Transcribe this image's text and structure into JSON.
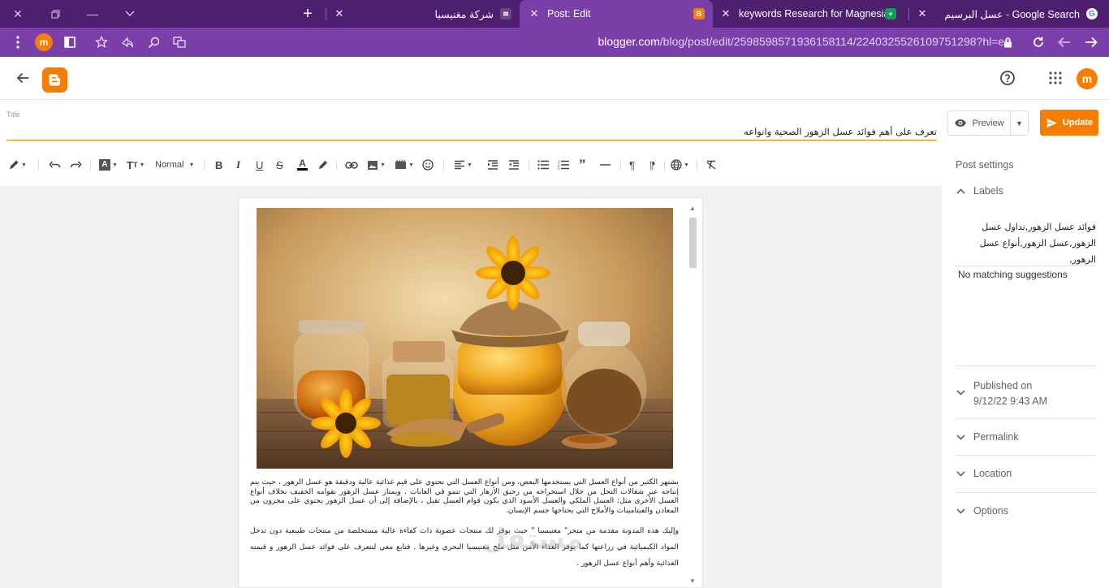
{
  "browser": {
    "tabs": [
      {
        "title": "عسل البرسيم - Google Search",
        "favicon": "google-icon"
      },
      {
        "title": "keywords Research for Magnesia",
        "favicon": "sheets-icon"
      },
      {
        "title": "Post: Edit",
        "favicon": "blogger-icon"
      },
      {
        "title": "شركة مغنيسيا",
        "favicon": "site-icon"
      }
    ],
    "url_host": "blogger.com",
    "url_path": "/blog/post/edit/2598598571936158114/2240325526109751298?hl=en",
    "profile_initial": "m"
  },
  "header": {
    "avatar_initial": "m"
  },
  "post": {
    "title_label": "Title",
    "title": "تعرف على أهم فوائد عسل الزهور الصحية وانواعه",
    "preview_label": "Preview",
    "update_label": "Update",
    "paragraph_style": "Normal",
    "body_p1": "يشتهر الكثير من أنواع العسل التي يستخدمها البعض، ومن أنواع العسل التي تحتوي على قيم غذائية عالية ودقيقة هو عسل الزهور ، حيث يتم إنتاجه عبر شغالات النحل من خلال استخراجه من رحيق الأزهار التي تنمو في الغابات . ويمتاز عسل الزهور بقوامه الخفيف بخلاف أنواع العسل الأخرى مثل: العسل الملكي والعسل الأسود  الذي يكون قوام العسل ثقيل ، بالإضافة إلى أن عسل الزهور يحتوي على مخزون من المعادن والفيتامينات والأملاح التي يحتاجها جسم الإنسان.",
    "body_p2": "وإليك هذه المدونة مقدمة من متجر\" مغنيسيا \" حيث يوفر لك منتجات عضوية ذات كفاءة عالية مستخلصة من منتجات طبيعية دون تدخل المواد الكيميائية في زراعتها كما يوفر الغذاء الأمن مثل ملح مغنيسيا البحري وغيرها . فتابع معي لتتعرف على فوائد عسل الزهور و قيمته الغذائية  وأهم أنواع عسل الزهور ."
  },
  "sidebar": {
    "heading": "Post settings",
    "labels_heading": "Labels",
    "labels_value": "فوائد عسل الزهور,تداول عسل الزهور,عسل الزهور,أنواع عسل الزهور,",
    "no_match": "No matching suggestions",
    "published_heading": "Published on",
    "published_value": "9/12/22 9:43 AM",
    "permalink": "Permalink",
    "location": "Location",
    "options": "Options"
  },
  "watermark": "مستقل mostaql.com",
  "colors": {
    "browser_dark": "#4d1f6e",
    "browser_mid": "#7a3fa8",
    "blogger_orange": "#f57d00"
  }
}
